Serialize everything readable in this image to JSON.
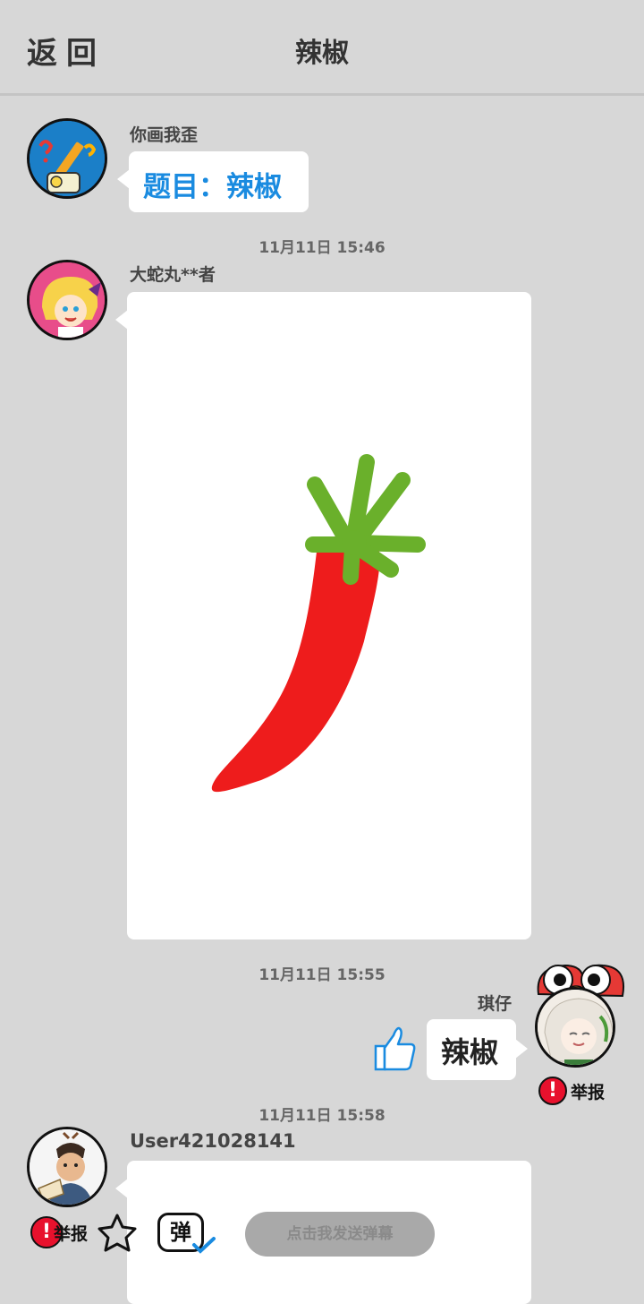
{
  "header": {
    "back_label": "返回",
    "title": "辣椒"
  },
  "messages": [
    {
      "username": "你画我歪",
      "topic": "题目：辣椒"
    },
    {
      "timestamp": "11月11日  15:46",
      "username": "大蛇丸**者"
    },
    {
      "timestamp": "11月11日  15:55",
      "username": "琪仔",
      "answer": "辣椒",
      "report_label": "举报"
    },
    {
      "timestamp": "11月11日  15:58",
      "username": "User421028141"
    }
  ],
  "bottom_bar": {
    "report_label": "举报",
    "danmaku_icon_text": "弹",
    "danmaku_placeholder": "点击我发送弹幕"
  },
  "colors": {
    "background": "#d7d7d7",
    "topic_blue": "#1a8be0",
    "pepper_red": "#ee1c1c",
    "stem_green": "#6ab02b",
    "report_red": "#e8112d"
  }
}
